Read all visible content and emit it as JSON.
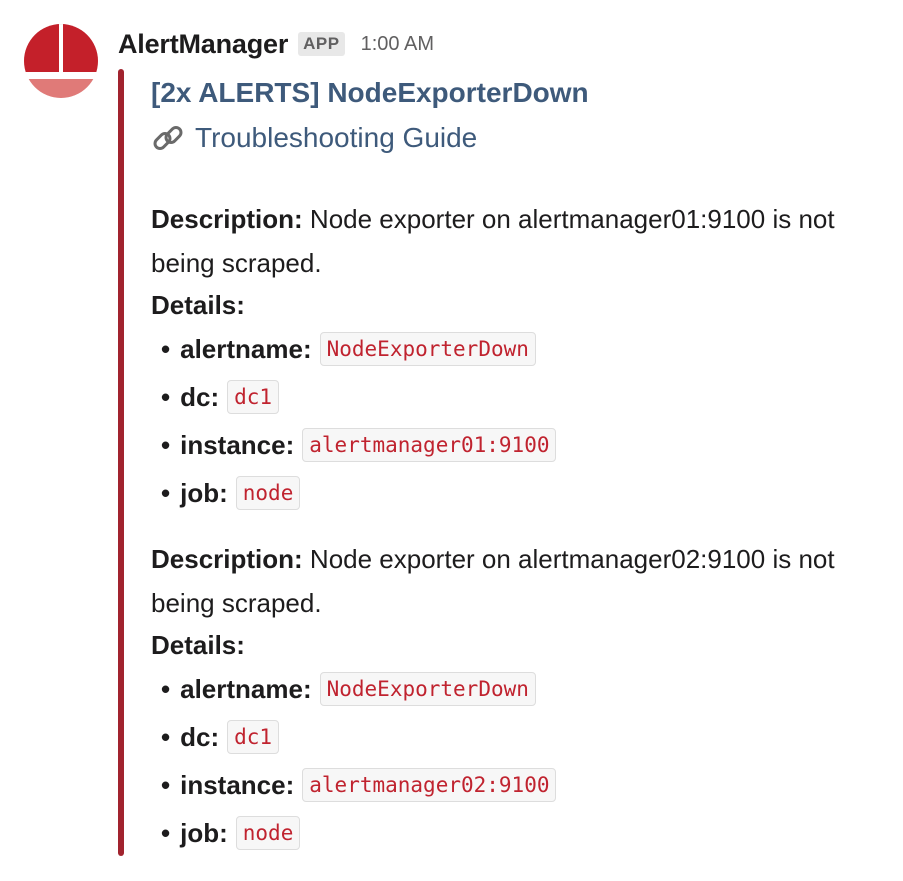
{
  "message": {
    "sender": "AlertManager",
    "badge": "APP",
    "time": "1:00 AM"
  },
  "attachment": {
    "accent_color": "#a1232e",
    "title": "[2x ALERTS] NodeExporterDown",
    "guide_icon": "link-icon",
    "guide_link": "Troubleshooting Guide",
    "alerts": [
      {
        "description_label": "Description:",
        "description": "Node exporter on alertmanager01:9100 is not being scraped.",
        "details_label": "Details:",
        "details": [
          {
            "key": "alertname:",
            "value": "NodeExporterDown"
          },
          {
            "key": "dc:",
            "value": "dc1"
          },
          {
            "key": "instance:",
            "value": "alertmanager01:9100"
          },
          {
            "key": "job:",
            "value": "node"
          }
        ]
      },
      {
        "description_label": "Description:",
        "description": "Node exporter on alertmanager02:9100 is not being scraped.",
        "details_label": "Details:",
        "details": [
          {
            "key": "alertname:",
            "value": "NodeExporterDown"
          },
          {
            "key": "dc:",
            "value": "dc1"
          },
          {
            "key": "instance:",
            "value": "alertmanager02:9100"
          },
          {
            "key": "job:",
            "value": "node"
          }
        ]
      }
    ]
  }
}
